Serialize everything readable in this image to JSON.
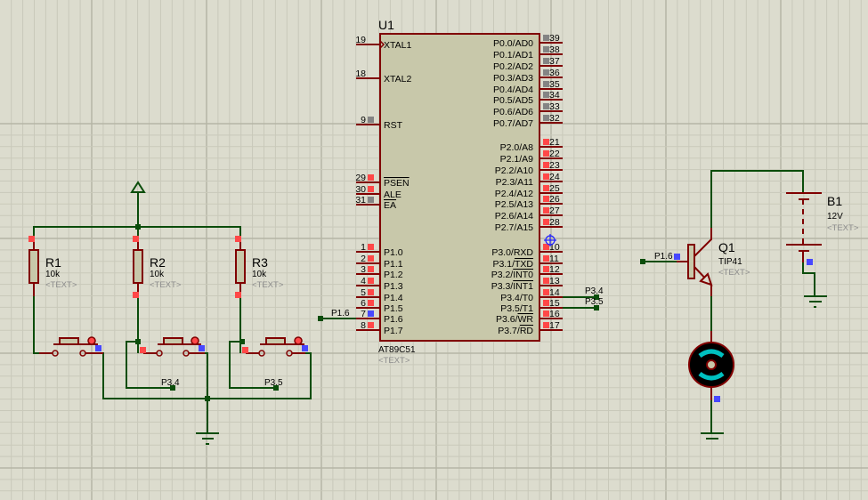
{
  "colors": {
    "background": "#dcdcce",
    "grid_minor": "#c9c9ba",
    "grid_major": "#b5b5a5",
    "wire": "#0b4d0b",
    "component": "#800000",
    "chip_fill": "#c8c8aa",
    "pin_red": "#ff4848",
    "pin_blue": "#4848ff",
    "pin_gray": "#848484",
    "motor_accent": "#00c0c0"
  },
  "u1": {
    "ref": "U1",
    "part": "AT89C51",
    "text": "<TEXT>",
    "left_pins": [
      {
        "num": "19",
        "name": "XTAL1",
        "state": "none",
        "clock": true
      },
      {
        "num": "18",
        "name": "XTAL2",
        "state": "none"
      },
      {
        "num": "9",
        "name": "RST",
        "state": "gray"
      },
      {
        "num": "29",
        "name": "",
        "bar": "PSEN",
        "state": "red"
      },
      {
        "num": "30",
        "name": "ALE",
        "state": "red"
      },
      {
        "num": "31",
        "name": "",
        "bar": "EA",
        "state": "gray"
      },
      {
        "num": "1",
        "name": "P1.0",
        "state": "red"
      },
      {
        "num": "2",
        "name": "P1.1",
        "state": "red"
      },
      {
        "num": "3",
        "name": "P1.2",
        "state": "red"
      },
      {
        "num": "4",
        "name": "P1.3",
        "state": "red"
      },
      {
        "num": "5",
        "name": "P1.4",
        "state": "red"
      },
      {
        "num": "6",
        "name": "P1.5",
        "state": "red"
      },
      {
        "num": "7",
        "name": "P1.6",
        "state": "blue"
      },
      {
        "num": "8",
        "name": "P1.7",
        "state": "red"
      }
    ],
    "right_pins": [
      {
        "num": "39",
        "name": "P0.0/AD0",
        "state": "gray"
      },
      {
        "num": "38",
        "name": "P0.1/AD1",
        "state": "gray"
      },
      {
        "num": "37",
        "name": "P0.2/AD2",
        "state": "gray"
      },
      {
        "num": "36",
        "name": "P0.3/AD3",
        "state": "gray"
      },
      {
        "num": "35",
        "name": "P0.4/AD4",
        "state": "gray"
      },
      {
        "num": "34",
        "name": "P0.5/AD5",
        "state": "gray"
      },
      {
        "num": "33",
        "name": "P0.6/AD6",
        "state": "gray"
      },
      {
        "num": "32",
        "name": "P0.7/AD7",
        "state": "gray"
      },
      {
        "num": "21",
        "name": "P2.0/A8",
        "state": "red"
      },
      {
        "num": "22",
        "name": "P2.1/A9",
        "state": "red"
      },
      {
        "num": "23",
        "name": "P2.2/A10",
        "state": "red"
      },
      {
        "num": "24",
        "name": "P2.3/A11",
        "state": "red"
      },
      {
        "num": "25",
        "name": "P2.4/A12",
        "state": "red"
      },
      {
        "num": "26",
        "name": "P2.5/A13",
        "state": "red"
      },
      {
        "num": "27",
        "name": "P2.6/A14",
        "state": "red"
      },
      {
        "num": "28",
        "name": "P2.7/A15",
        "state": "red"
      },
      {
        "num": "10",
        "name": "P3.0/RXD",
        "state": "red"
      },
      {
        "num": "11",
        "name": "P3.1/",
        "bar": "TXD",
        "state": "red"
      },
      {
        "num": "12",
        "name": "P3.2/",
        "bar": "INT0",
        "state": "red"
      },
      {
        "num": "13",
        "name": "P3.3/",
        "bar": "INT1",
        "state": "red"
      },
      {
        "num": "14",
        "name": "P3.4/T0",
        "state": "red"
      },
      {
        "num": "15",
        "name": "P3.5/T1",
        "state": "red"
      },
      {
        "num": "16",
        "name": "P3.6/",
        "bar": "WR",
        "state": "red"
      },
      {
        "num": "17",
        "name": "P3.7/",
        "bar": "RD",
        "state": "red"
      }
    ]
  },
  "resistors": [
    {
      "ref": "R1",
      "value": "10k",
      "text": "<TEXT>"
    },
    {
      "ref": "R2",
      "value": "10k",
      "text": "<TEXT>"
    },
    {
      "ref": "R3",
      "value": "10k",
      "text": "<TEXT>"
    }
  ],
  "transistor": {
    "ref": "Q1",
    "part": "TIP41",
    "text": "<TEXT>"
  },
  "battery": {
    "ref": "B1",
    "value": "12V",
    "text": "<TEXT>"
  },
  "net_labels": {
    "p1_6_left": "P1.6",
    "p1_6_right": "P1.6",
    "p3_4_chip": "P3.4",
    "p3_5_chip": "P3.5",
    "p3_4_switch": "P3.4",
    "p3_5_switch": "P3.5"
  }
}
